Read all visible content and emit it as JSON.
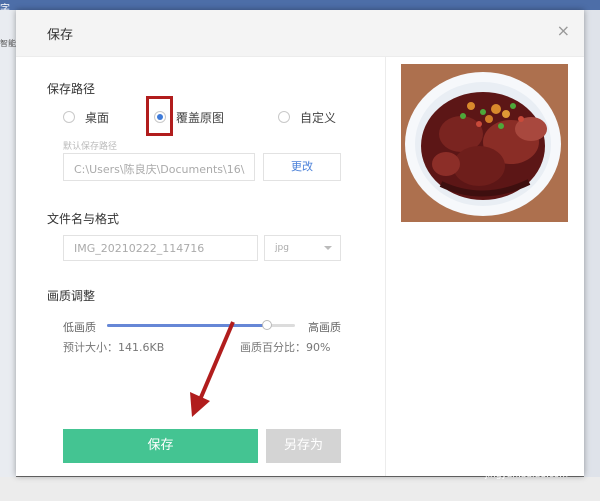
{
  "dialog": {
    "title": "保存",
    "close_icon": "close-icon"
  },
  "save_path": {
    "title": "保存路径",
    "options": [
      {
        "label": "桌面",
        "checked": false
      },
      {
        "label": "覆盖原图",
        "checked": true
      },
      {
        "label": "自定义",
        "checked": false
      }
    ],
    "hint": "默认保存路径",
    "path_value": "C:\\Users\\陈良庆\\Documents\\16\\",
    "change_label": "更改"
  },
  "filename": {
    "title": "文件名与格式",
    "value": "IMG_20210222_114716",
    "format": "jpg"
  },
  "quality": {
    "title": "画质调整",
    "low_label": "低画质",
    "high_label": "高画质",
    "level": 0.85,
    "file_size": "预计大小：141.6KB",
    "percent": "画质百分比：90%"
  },
  "buttons": {
    "save": "保存",
    "save_as": "另存为"
  },
  "background": {
    "top_left": "字",
    "left_label": "智能"
  },
  "watermark": {
    "brand": "Bai经验",
    "url": "jingyan.baidu.com"
  },
  "colors": {
    "accent": "#3f7bd9",
    "save_button": "#44c492",
    "highlight": "#b11d1d"
  }
}
